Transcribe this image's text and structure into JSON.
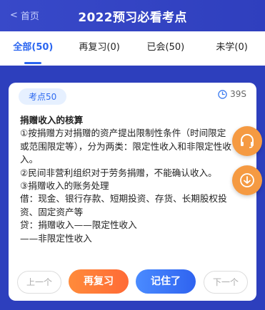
{
  "header": {
    "back_label": "首页",
    "title": "2022预习必看考点"
  },
  "tabs": [
    {
      "label": "全部(50)",
      "active": true
    },
    {
      "label": "再复习(0)",
      "active": false
    },
    {
      "label": "已会(50)",
      "active": false
    },
    {
      "label": "未学(0)",
      "active": false
    }
  ],
  "card": {
    "badge": "考点50",
    "timer": "39S",
    "heading": "捐赠收入的核算",
    "lines": [
      "①按捐赠方对捐赠的资产提出限制性条件（时间限定或范围限定等），分为两类：限定性收入和非限定性收入。",
      "②民间非营利组织对于劳务捐赠，不能确认收入。",
      "③捐赠收入的账务处理",
      "借：现金、银行存款、短期投资、存货、长期股权投资、固定资产等",
      "贷：捐赠收入——限定性收入",
      "——非限定性收入"
    ],
    "buttons": {
      "prev": "上一个",
      "review": "再复习",
      "remember": "记住了",
      "next": "下一个"
    }
  },
  "colors": {
    "header_bg": "#3849c9",
    "active_tab": "#2b66f0",
    "orange": "#ff7a3a",
    "blue": "#3d78f6"
  }
}
